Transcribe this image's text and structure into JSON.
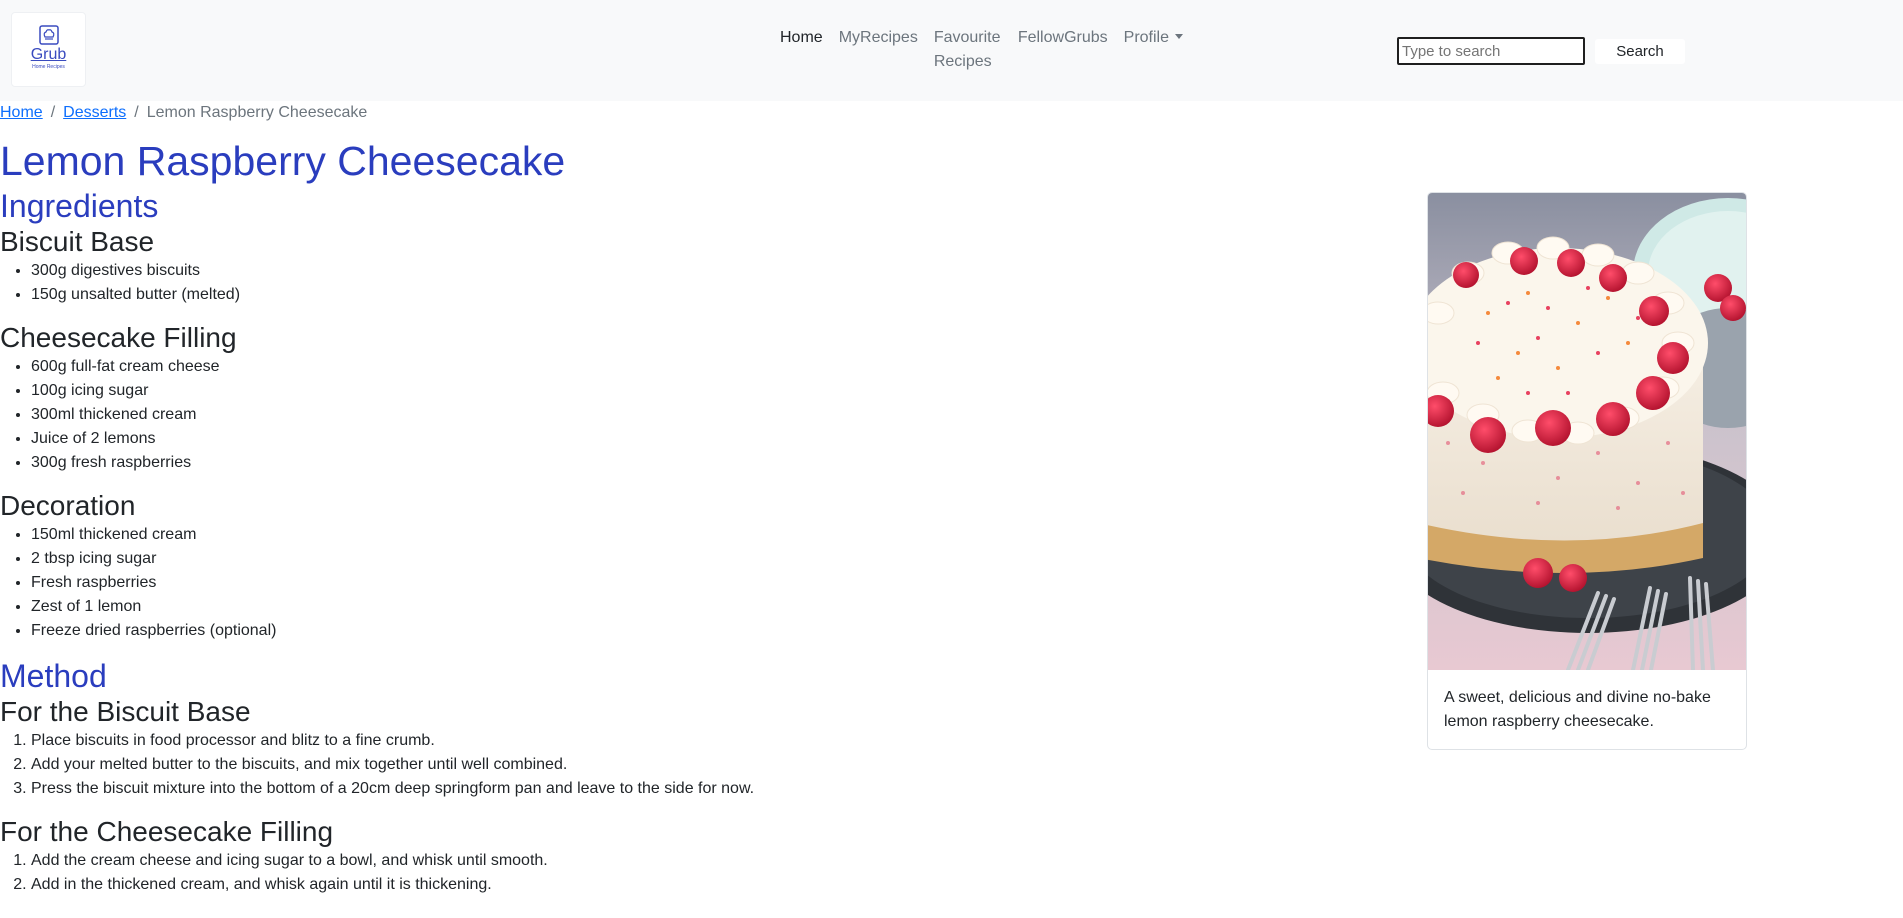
{
  "brand": {
    "name": "Grub",
    "tagline": "Home Recipes"
  },
  "nav": {
    "home": "Home",
    "my_recipes": "MyRecipes",
    "favourite_recipes": "Favourite Recipes",
    "fellow_grubs": "FellowGrubs",
    "profile": "Profile"
  },
  "search": {
    "placeholder": "Type to search",
    "value": "",
    "button_label": "Search"
  },
  "breadcrumb": {
    "home": "Home",
    "category": "Desserts",
    "separator": "/",
    "current": "Lemon Raspberry Cheesecake"
  },
  "recipe": {
    "title": "Lemon Raspberry Cheesecake",
    "ingredients_heading": "Ingredients",
    "ingredient_groups": [
      {
        "name": "Biscuit Base",
        "items": [
          "300g digestives biscuits",
          "150g unsalted butter (melted)"
        ]
      },
      {
        "name": "Cheesecake Filling",
        "items": [
          "600g full-fat cream cheese",
          "100g icing sugar",
          "300ml thickened cream",
          "Juice of 2 lemons",
          "300g fresh raspberries"
        ]
      },
      {
        "name": "Decoration",
        "items": [
          "150ml thickened cream",
          "2 tbsp icing sugar",
          "Fresh raspberries",
          "Zest of 1 lemon",
          "Freeze dried raspberries (optional)"
        ]
      }
    ],
    "method_heading": "Method",
    "method_groups": [
      {
        "name": "For the Biscuit Base",
        "steps": [
          "Place biscuits in food processor and blitz to a fine crumb.",
          "Add your melted butter to the biscuits, and mix together until well combined.",
          "Press the biscuit mixture into the bottom of a 20cm deep springform pan and leave to the side for now."
        ]
      },
      {
        "name": "For the Cheesecake Filling",
        "steps": [
          "Add the cream cheese and icing sugar to a bowl, and whisk until smooth.",
          "Add in the thickened cream, and whisk again until it is thickening."
        ]
      }
    ]
  },
  "card": {
    "caption": "A sweet, delicious and divine no-bake lemon raspberry cheesecake."
  },
  "colors": {
    "heading_blue": "#2a3dbe",
    "link_blue": "#0d6efd",
    "navbar_bg": "#f8f9fa",
    "muted": "#6c757d"
  }
}
